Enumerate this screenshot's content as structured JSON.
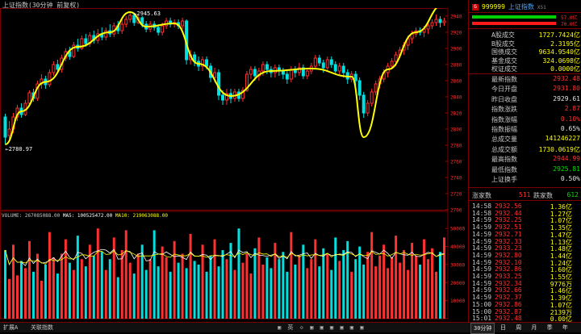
{
  "header": {
    "title": "上证指数(30分钟 前复权)"
  },
  "price_chart": {
    "y_axis_labels": [
      "2940",
      "2920",
      "2900",
      "2880",
      "2860",
      "2840",
      "2820",
      "2800",
      "2780",
      "2760",
      "2740",
      "2720",
      "2700"
    ],
    "y_min": 2700,
    "y_max": 2950,
    "high_label": "2945.63",
    "low_label": "2780.97",
    "candles": [
      [
        2815,
        2790,
        2819,
        2781
      ],
      [
        2792,
        2800,
        2810,
        2788
      ],
      [
        2800,
        2815,
        2820,
        2795
      ],
      [
        2815,
        2826,
        2830,
        2810
      ],
      [
        2826,
        2818,
        2832,
        2814
      ],
      [
        2818,
        2832,
        2836,
        2816
      ],
      [
        2832,
        2845,
        2848,
        2828
      ],
      [
        2845,
        2838,
        2850,
        2834
      ],
      [
        2838,
        2856,
        2860,
        2835
      ],
      [
        2856,
        2862,
        2868,
        2850
      ],
      [
        2862,
        2855,
        2866,
        2850
      ],
      [
        2855,
        2870,
        2874,
        2852
      ],
      [
        2870,
        2880,
        2884,
        2866
      ],
      [
        2880,
        2874,
        2886,
        2870
      ],
      [
        2874,
        2888,
        2892,
        2870
      ],
      [
        2888,
        2896,
        2900,
        2884
      ],
      [
        2896,
        2890,
        2902,
        2886
      ],
      [
        2890,
        2904,
        2908,
        2888
      ],
      [
        2904,
        2900,
        2912,
        2896
      ],
      [
        2900,
        2912,
        2916,
        2898
      ],
      [
        2912,
        2906,
        2918,
        2902
      ],
      [
        2906,
        2916,
        2920,
        2902
      ],
      [
        2916,
        2910,
        2922,
        2906
      ],
      [
        2910,
        2918,
        2924,
        2906
      ],
      [
        2918,
        2914,
        2926,
        2910
      ],
      [
        2914,
        2922,
        2926,
        2910
      ],
      [
        2922,
        2918,
        2930,
        2914
      ],
      [
        2918,
        2928,
        2932,
        2914
      ],
      [
        2928,
        2922,
        2934,
        2918
      ],
      [
        2922,
        2930,
        2936,
        2918
      ],
      [
        2930,
        2936,
        2940,
        2926
      ],
      [
        2936,
        2941,
        2945,
        2932
      ],
      [
        2941,
        2932,
        2944,
        2928
      ],
      [
        2932,
        2938,
        2942,
        2930
      ],
      [
        2938,
        2930,
        2940,
        2926
      ],
      [
        2930,
        2924,
        2934,
        2920
      ],
      [
        2924,
        2930,
        2934,
        2920
      ],
      [
        2930,
        2926,
        2934,
        2922
      ],
      [
        2926,
        2920,
        2930,
        2916
      ],
      [
        2920,
        2928,
        2932,
        2916
      ],
      [
        2928,
        2934,
        2938,
        2924
      ],
      [
        2934,
        2930,
        2938,
        2926
      ],
      [
        2930,
        2932,
        2936,
        2926
      ],
      [
        2932,
        2928,
        2936,
        2924
      ],
      [
        2928,
        2934,
        2938,
        2924
      ],
      [
        2934,
        2886,
        2936,
        2880
      ],
      [
        2886,
        2892,
        2898,
        2880
      ],
      [
        2892,
        2884,
        2896,
        2878
      ],
      [
        2884,
        2878,
        2890,
        2872
      ],
      [
        2878,
        2886,
        2890,
        2872
      ],
      [
        2886,
        2878,
        2890,
        2874
      ],
      [
        2878,
        2864,
        2882,
        2858
      ],
      [
        2864,
        2870,
        2876,
        2858
      ],
      [
        2870,
        2842,
        2874,
        2836
      ],
      [
        2842,
        2836,
        2848,
        2830
      ],
      [
        2836,
        2844,
        2850,
        2830
      ],
      [
        2844,
        2838,
        2850,
        2832
      ],
      [
        2838,
        2846,
        2850,
        2834
      ],
      [
        2846,
        2838,
        2850,
        2834
      ],
      [
        2838,
        2848,
        2852,
        2834
      ],
      [
        2848,
        2868,
        2872,
        2846
      ],
      [
        2868,
        2874,
        2878,
        2862
      ],
      [
        2874,
        2866,
        2878,
        2860
      ],
      [
        2866,
        2872,
        2876,
        2860
      ],
      [
        2872,
        2880,
        2884,
        2866
      ],
      [
        2880,
        2874,
        2884,
        2868
      ],
      [
        2874,
        2870,
        2878,
        2864
      ],
      [
        2870,
        2876,
        2880,
        2864
      ],
      [
        2876,
        2872,
        2880,
        2866
      ],
      [
        2872,
        2868,
        2876,
        2862
      ],
      [
        2868,
        2862,
        2872,
        2856
      ],
      [
        2862,
        2874,
        2878,
        2858
      ],
      [
        2874,
        2870,
        2878,
        2864
      ],
      [
        2870,
        2876,
        2882,
        2866
      ],
      [
        2876,
        2866,
        2880,
        2862
      ],
      [
        2866,
        2872,
        2876,
        2862
      ],
      [
        2872,
        2878,
        2882,
        2868
      ],
      [
        2878,
        2888,
        2892,
        2874
      ],
      [
        2888,
        2882,
        2892,
        2878
      ],
      [
        2882,
        2876,
        2886,
        2870
      ],
      [
        2876,
        2886,
        2890,
        2872
      ],
      [
        2886,
        2880,
        2890,
        2876
      ],
      [
        2880,
        2872,
        2884,
        2868
      ],
      [
        2872,
        2878,
        2882,
        2866
      ],
      [
        2878,
        2870,
        2882,
        2864
      ],
      [
        2870,
        2862,
        2874,
        2856
      ],
      [
        2862,
        2868,
        2872,
        2858
      ],
      [
        2868,
        2860,
        2872,
        2854
      ],
      [
        2860,
        2842,
        2864,
        2836
      ],
      [
        2842,
        2820,
        2846,
        2814
      ],
      [
        2820,
        2832,
        2836,
        2816
      ],
      [
        2832,
        2846,
        2850,
        2828
      ],
      [
        2846,
        2856,
        2860,
        2842
      ],
      [
        2856,
        2862,
        2866,
        2850
      ],
      [
        2862,
        2870,
        2874,
        2858
      ],
      [
        2870,
        2878,
        2882,
        2864
      ],
      [
        2878,
        2884,
        2888,
        2874
      ],
      [
        2884,
        2892,
        2896,
        2878
      ],
      [
        2892,
        2898,
        2902,
        2888
      ],
      [
        2898,
        2904,
        2908,
        2892
      ],
      [
        2904,
        2912,
        2916,
        2898
      ],
      [
        2912,
        2918,
        2922,
        2906
      ],
      [
        2918,
        2922,
        2926,
        2914
      ],
      [
        2922,
        2920,
        2926,
        2916
      ],
      [
        2920,
        2924,
        2928,
        2914
      ],
      [
        2924,
        2928,
        2932,
        2918
      ],
      [
        2928,
        2932,
        2936,
        2924
      ],
      [
        2932,
        2936,
        2942,
        2928
      ],
      [
        2936,
        2932,
        2940,
        2926
      ],
      [
        2932,
        2934,
        2938,
        2928
      ]
    ]
  },
  "volume_chart": {
    "legend_volume": "VOLUME: 267085088.00",
    "legend_ma5": "MA5: 100525472.00",
    "legend_ma10": "MA10: 219063088.00",
    "y_axis_labels": [
      "50000",
      "40000",
      "30000",
      "20000",
      "10000"
    ],
    "y_max": 55000,
    "bars": [
      38,
      22,
      41,
      24,
      32,
      28,
      43,
      26,
      36,
      21,
      30,
      48,
      34,
      25,
      36,
      44,
      31,
      27,
      46,
      33,
      29,
      41,
      35,
      50,
      37,
      27,
      33,
      45,
      23,
      38,
      49,
      31,
      25,
      36,
      41,
      27,
      33,
      49,
      29,
      40,
      34,
      26,
      43,
      31,
      36,
      28,
      47,
      32,
      30,
      41,
      26,
      35,
      44,
      29,
      38,
      33,
      42,
      27,
      50,
      31,
      36,
      25,
      39,
      45,
      30,
      34,
      28,
      42,
      33,
      37,
      26,
      48,
      30,
      35,
      41,
      28,
      33,
      44,
      29,
      39,
      36,
      27,
      45,
      32,
      38,
      43,
      26,
      33,
      40,
      30,
      37,
      48,
      29,
      35,
      41,
      28,
      34,
      46,
      31,
      38,
      27,
      42,
      35,
      30,
      44,
      33,
      39,
      26,
      37,
      45
    ],
    "dates": [
      "11:14",
      "11:30",
      "13:30",
      "14:00",
      "14:30",
      "11:00",
      "11:30",
      "14:00",
      "14:30",
      "11:00",
      "11:30",
      "13:30",
      "14:00",
      "14:30",
      "11:00",
      "11:30",
      "13:30",
      "14:00",
      "14:30",
      "11:00",
      "11:30",
      "14:00",
      "14:30"
    ]
  },
  "right_panel": {
    "code": "999999",
    "name": "上证指数",
    "suffix": "XS1",
    "ratio_top": "57.0亿",
    "ratio_bottom": "70.0亿",
    "rows1": [
      {
        "k": "A股成交",
        "v": "1727.7424亿"
      },
      {
        "k": "B股成交",
        "v": "2.3195亿"
      },
      {
        "k": "国债成交",
        "v": "9634.9540亿"
      },
      {
        "k": "基金成交",
        "v": "324.0698亿"
      },
      {
        "k": "权证成交",
        "v": "0.0000亿"
      }
    ],
    "rows2": [
      {
        "k": "最新指数",
        "v": "2932.48",
        "c": "#ff3030"
      },
      {
        "k": "今日开盘",
        "v": "2931.80",
        "c": "#ff3030"
      },
      {
        "k": "昨日收盘",
        "v": "2929.61",
        "c": "#e0e0e0"
      },
      {
        "k": "指数涨跌",
        "v": "2.87",
        "c": "#ff3030"
      },
      {
        "k": "指数涨幅",
        "v": "0.10%",
        "c": "#ff3030"
      },
      {
        "k": "指数振幅",
        "v": "0.65%",
        "c": "#e0e0e0"
      },
      {
        "k": "总成交量",
        "v": "141246227",
        "c": "#ffff00"
      },
      {
        "k": "总成交额",
        "v": "1730.0619亿",
        "c": "#ffff00"
      },
      {
        "k": "最高指数",
        "v": "2944.99",
        "c": "#ff3030"
      },
      {
        "k": "最低指数",
        "v": "2925.81",
        "c": "#00e000"
      },
      {
        "k": "上证换手",
        "v": "0.50%",
        "c": "#e0e0e0"
      }
    ],
    "up_label": "涨家数",
    "up_count": "511",
    "down_label": "跌家数",
    "down_count": "612",
    "ticks": [
      {
        "t": "14:58",
        "p": "2932.56",
        "v": "1.36亿"
      },
      {
        "t": "14:58",
        "p": "2932.44",
        "v": "1.27亿"
      },
      {
        "t": "14:59",
        "p": "2932.25",
        "v": "1.07亿"
      },
      {
        "t": "14:59",
        "p": "2932.51",
        "v": "1.35亿"
      },
      {
        "t": "14:59",
        "p": "2932.71",
        "v": "1.47亿"
      },
      {
        "t": "14:59",
        "p": "2932.33",
        "v": "1.13亿"
      },
      {
        "t": "14:59",
        "p": "2933.23",
        "v": "1.48亿"
      },
      {
        "t": "14:59",
        "p": "2932.80",
        "v": "1.44亿"
      },
      {
        "t": "14:59",
        "p": "2932.10",
        "v": "1.24亿"
      },
      {
        "t": "14:59",
        "p": "2932.86",
        "v": "1.60亿"
      },
      {
        "t": "14:59",
        "p": "2933.25",
        "v": "1.55亿"
      },
      {
        "t": "14:59",
        "p": "2932.34",
        "v": "9776万"
      },
      {
        "t": "14:59",
        "p": "2932.66",
        "v": "1.46亿"
      },
      {
        "t": "14:59",
        "p": "2932.37",
        "v": "1.39亿"
      },
      {
        "t": "15:00",
        "p": "2932.86",
        "v": "1.07亿"
      },
      {
        "t": "15:00",
        "p": "2932.87",
        "v": "2139万"
      },
      {
        "t": "15:01",
        "p": "2932.48",
        "v": "0.00亿"
      }
    ]
  },
  "bottom_bar": {
    "tab1": "扩展A",
    "tab2": "关联指数",
    "icons": "▣ 英 ◇ ▣ ▣ ▣ ▣ ▣ ▣",
    "period": "30分钟",
    "right_icons": "日 周 月 季 年"
  },
  "colors": {
    "up": "#ff3030",
    "down": "#00e0e0",
    "ma5": "#ffffff",
    "ma10": "#ffff00",
    "trend": "#ffff00",
    "grid": "#7a0000"
  }
}
